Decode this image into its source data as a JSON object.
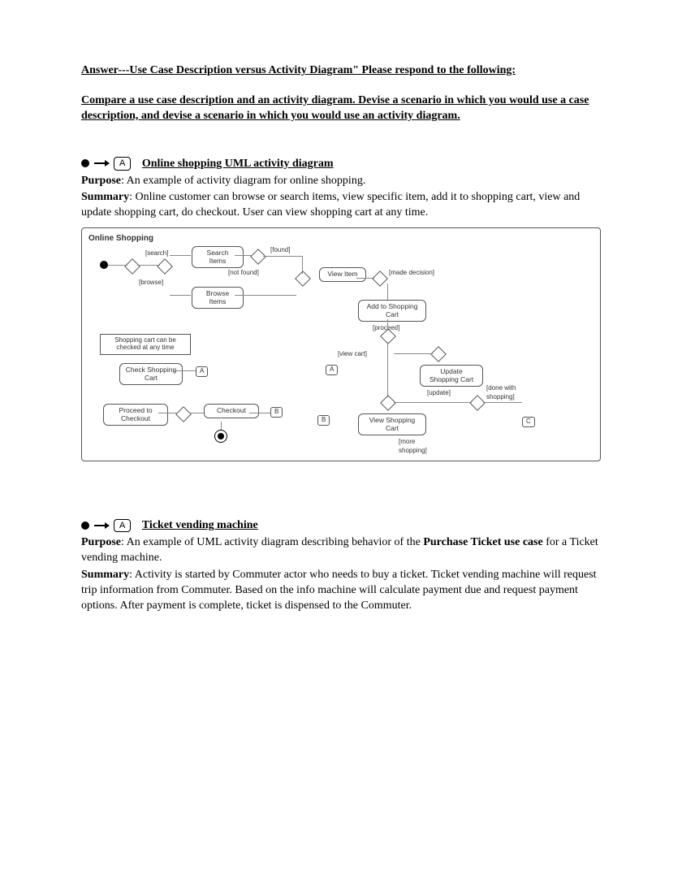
{
  "header": {
    "line1": "Answer---Use Case Description versus Activity Diagram\"  Please respond to the following:",
    "line2": "Compare a use case description and an activity diagram. Devise a scenario in which you would use a case description, and devise a scenario in which you would use an activity diagram."
  },
  "connector_label": "A",
  "section1": {
    "title": "Online shopping UML activity diagram",
    "purpose_label": "Purpose",
    "purpose_text": ": An example of activity diagram for online shopping.",
    "summary_label": "Summary",
    "summary_text": ": Online customer can browse or search items, view specific item, add it to shopping cart, view and update shopping cart, do checkout. User can view shopping cart at any time."
  },
  "diagram": {
    "title": "Online Shopping",
    "nodes": {
      "search_items": "Search\nItems",
      "browse_items": "Browse\nItems",
      "view_item": "View\nItem",
      "add_to_cart": "Add to\nShopping Cart",
      "update_cart": "Update\nShopping Cart",
      "view_cart": "View\nShopping Cart",
      "check_cart": "Check\nShopping Cart",
      "proceed": "Proceed to\nCheckout",
      "checkout": "Checkout"
    },
    "guards": {
      "search": "[search]",
      "browse": "[browse]",
      "found": "[found]",
      "not_found": "[not found]",
      "made_decision": "[made decision]",
      "proceed": "[proceed]",
      "view_cart": "[view cart]",
      "update": "[update]",
      "done": "[done with\nshopping]",
      "more": "[more\nshopping]"
    },
    "note": "Shopping cart can be\nchecked at any time",
    "connectors": {
      "a": "A",
      "b": "B",
      "c": "C"
    }
  },
  "section2": {
    "title": "Ticket vending machine",
    "purpose_label": "Purpose",
    "purpose_text_a": ": An example of UML activity diagram describing behavior of the ",
    "purpose_bold": "Purchase Ticket use case",
    "purpose_text_b": " for a Ticket vending machine.",
    "summary_label": "Summary",
    "summary_text": ": Activity is started by Commuter actor who needs to buy a ticket. Ticket vending machine will request trip information from Commuter. Based on the info machine will calculate payment due and request payment options. After payment is complete, ticket is dispensed to the Commuter."
  }
}
